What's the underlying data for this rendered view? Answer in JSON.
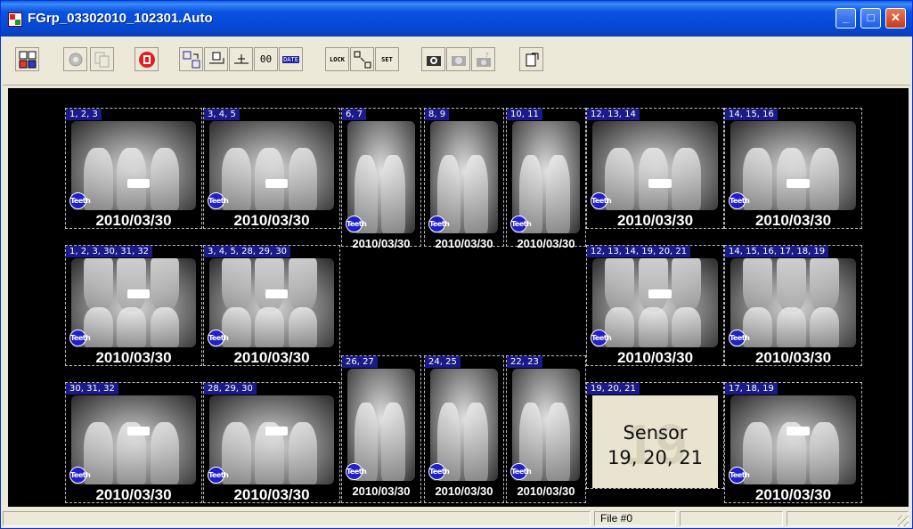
{
  "window": {
    "title": "FGrp_03302010_102301.Auto",
    "controls": {
      "minimize_glyph": "_",
      "maximize_glyph": "□",
      "close_glyph": "✕"
    }
  },
  "toolbar": {
    "buttons": [
      {
        "name": "layout-grid-icon"
      },
      {
        "name": "gear-disabled-icon"
      },
      {
        "name": "copy-pages-disabled-icon"
      },
      {
        "name": "stop-icon"
      },
      {
        "name": "select-move-icon"
      },
      {
        "name": "rotate-icon"
      },
      {
        "name": "align-icon"
      },
      {
        "name": "number-field-icon",
        "glyph": "00"
      },
      {
        "name": "date-icon",
        "glyph": "DATE"
      },
      {
        "name": "lock-icon",
        "glyph": "LOCK"
      },
      {
        "name": "arrange-icon"
      },
      {
        "name": "set-icon",
        "glyph": "SET"
      },
      {
        "name": "camera-acquire-icon"
      },
      {
        "name": "camera-disabled-icon"
      },
      {
        "name": "camera-help-disabled-icon"
      },
      {
        "name": "export-icon"
      }
    ]
  },
  "films": [
    {
      "label": "1, 2, 3",
      "date": "2010/03/30",
      "badge": "Teeth"
    },
    {
      "label": "3, 4, 5",
      "date": "2010/03/30",
      "badge": "Teeth"
    },
    {
      "label": "6, 7",
      "date": "2010/03/30",
      "badge": "Teeth"
    },
    {
      "label": "8, 9",
      "date": "2010/03/30",
      "badge": "Teeth"
    },
    {
      "label": "10, 11",
      "date": "2010/03/30",
      "badge": "Teeth"
    },
    {
      "label": "12, 13, 14",
      "date": "2010/03/30",
      "badge": "Teeth"
    },
    {
      "label": "14, 15, 16",
      "date": "2010/03/30",
      "badge": "Teeth"
    },
    {
      "label": "1, 2, 3, 30, 31, 32",
      "date": "2010/03/30",
      "badge": "Teeth"
    },
    {
      "label": "3, 4, 5, 28, 29, 30",
      "date": "2010/03/30",
      "badge": "Teeth"
    },
    {
      "label": "12, 13, 14, 19, 20, 21",
      "date": "2010/03/30",
      "badge": "Teeth"
    },
    {
      "label": "14, 15, 16, 17, 18, 19",
      "date": "2010/03/30",
      "badge": "Teeth"
    },
    {
      "label": "30, 31, 32",
      "date": "2010/03/30",
      "badge": "Teeth"
    },
    {
      "label": "28, 29, 30",
      "date": "2010/03/30",
      "badge": "Teeth"
    },
    {
      "label": "26, 27",
      "date": "2010/03/30",
      "badge": "Teeth"
    },
    {
      "label": "24, 25",
      "date": "2010/03/30",
      "badge": "Teeth"
    },
    {
      "label": "22, 23",
      "date": "2010/03/30",
      "badge": "Teeth"
    },
    {
      "label": "19, 20, 21",
      "date": "",
      "badge": "",
      "sensor_line1": "Sensor",
      "sensor_line2": "19, 20, 21",
      "ghost": "19"
    },
    {
      "label": "17, 18, 19",
      "date": "2010/03/30",
      "badge": "Teeth"
    }
  ],
  "statusbar": {
    "file": "File #0",
    "pane1": "",
    "pane3": "",
    "pane4": ""
  }
}
